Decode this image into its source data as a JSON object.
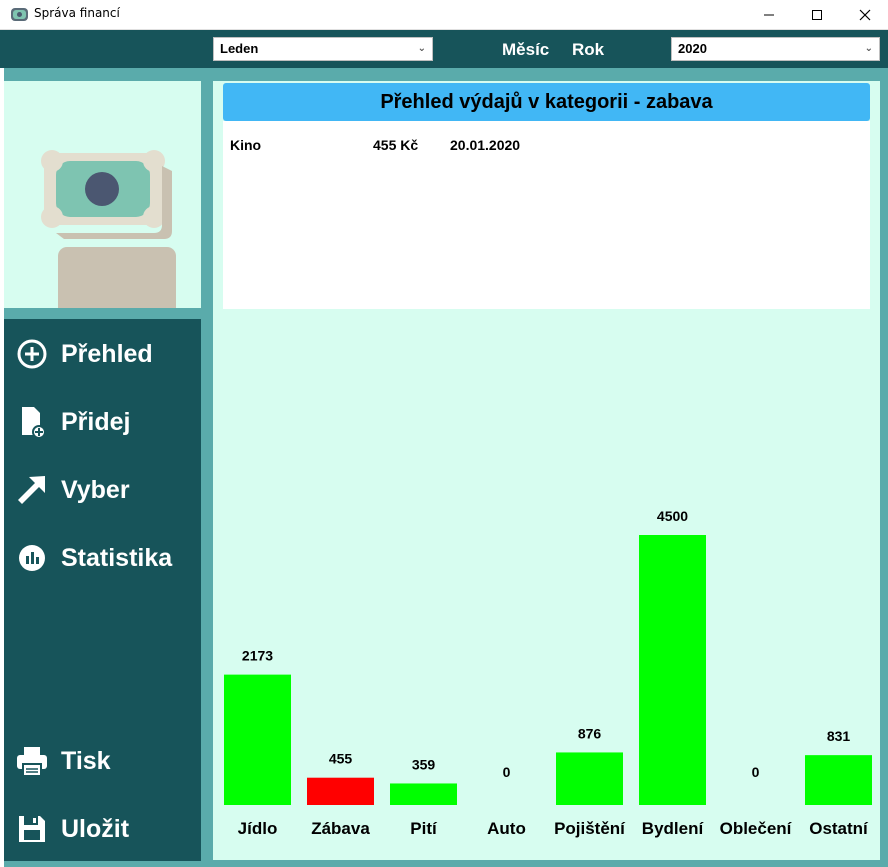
{
  "window": {
    "title": "Správa financí"
  },
  "topbar": {
    "month_value": "Leden",
    "month_label": "Měsíc",
    "year_label": "Rok",
    "year_value": "2020"
  },
  "sidebar": {
    "items": [
      {
        "label": "Přehled",
        "icon": "plus-circle-icon"
      },
      {
        "label": "Přidej",
        "icon": "add-file-icon"
      },
      {
        "label": "Vyber",
        "icon": "cursor-arrow-icon"
      },
      {
        "label": "Statistika",
        "icon": "stats-circle-icon"
      },
      {
        "label": "Tisk",
        "icon": "printer-icon"
      },
      {
        "label": "Uložit",
        "icon": "save-disk-icon"
      }
    ]
  },
  "expenses": {
    "header": "Přehled výdajů v kategorii - zabava",
    "rows": [
      {
        "name": "Kino",
        "amount": "455 Kč",
        "date": "20.01.2020"
      }
    ]
  },
  "chart_data": {
    "type": "bar",
    "categories": [
      "Jídlo",
      "Zábava",
      "Pití",
      "Auto",
      "Pojištění",
      "Bydlení",
      "Oblečení",
      "Ostatní"
    ],
    "values": [
      2173,
      455,
      359,
      0,
      876,
      4500,
      0,
      831
    ],
    "highlight_index": 1,
    "colors": {
      "bar": "#00ff00",
      "highlight": "#ff0000"
    },
    "ylim": [
      0,
      4500
    ],
    "grid": false
  },
  "colors": {
    "dark_teal": "#17545a",
    "frame_teal": "#5aabab",
    "mint": "#d7fdf0",
    "header_blue": "#41b7f5"
  }
}
